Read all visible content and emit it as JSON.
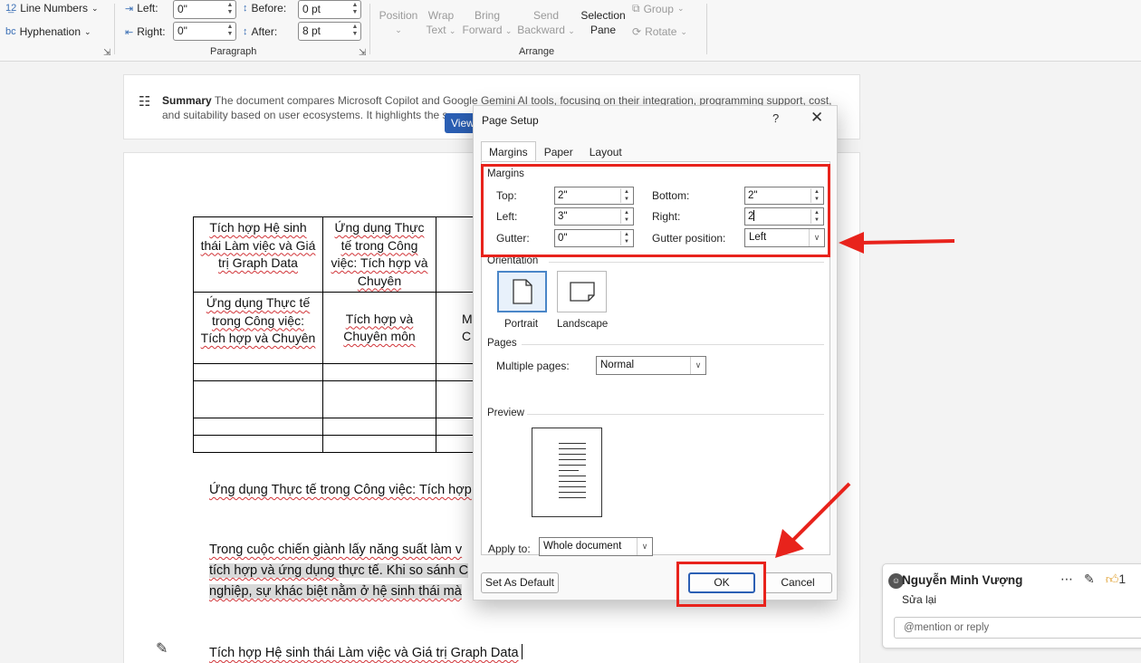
{
  "ribbon": {
    "line_numbers": "Line Numbers",
    "hyphenation": "Hyphenation",
    "indent_left_label": "Left:",
    "indent_left_value": "0\"",
    "indent_right_label": "Right:",
    "indent_right_value": "0\"",
    "spacing_before_label": "Before:",
    "spacing_before_value": "0 pt",
    "spacing_after_label": "After:",
    "spacing_after_value": "8 pt",
    "paragraph_group": "Paragraph",
    "position": "Position",
    "wrap_text": [
      "Wrap",
      "Text"
    ],
    "bring_forward": [
      "Bring",
      "Forward"
    ],
    "send_backward": [
      "Send",
      "Backward"
    ],
    "selection_pane": [
      "Selection",
      "Pane"
    ],
    "group": "Group",
    "rotate": "Rotate",
    "arrange_group": "Arrange"
  },
  "summary": {
    "label": "Summary",
    "text_line1": "The document compares Microsoft Copilot and Google Gemini AI tools, focusing on their integration, programming support, cost,",
    "text_line2": "and suitability based on user ecosystems. It highlights the s",
    "view_button": "View"
  },
  "document": {
    "table": {
      "r1c1": "Tích hợp Hệ sinh thái Làm việc và Giá trị Graph Data",
      "r1c2": "Ứng dụng Thực tế trong Công việc: Tích hợp và Chuyên",
      "r2c1": "Ứng dụng Thực tế trong Công việc: Tích hợp và Chuyên",
      "r2c2": "Tích hợp và Chuyên môn",
      "r2c3_partial": "M C"
    },
    "heading1": "Ứng dụng Thực tế trong Công việc: Tích hợp",
    "para_line1": "Trong cuộc chiến giành lấy năng suất làm v",
    "para_line2_a": "tích hợp và ứng dụng ",
    "para_line2_b": "thực tế. Khi so sánh C",
    "para_line3": "nghiệp, sự khác biệt nằm ở hệ sinh thái mà",
    "heading2": "Tích hợp Hệ sinh thái Làm việc và Giá trị Graph Data"
  },
  "dialog": {
    "title": "Page Setup",
    "help": "?",
    "close": "✕",
    "tabs": [
      "Margins",
      "Paper",
      "Layout"
    ],
    "margins_section": "Margins",
    "top_label": "Top:",
    "top_value": "2\"",
    "bottom_label": "Bottom:",
    "bottom_value": "2\"",
    "left_label": "Left:",
    "left_value": "3\"",
    "right_label": "Right:",
    "right_value": "2",
    "gutter_label": "Gutter:",
    "gutter_value": "0\"",
    "gutter_position_label": "Gutter position:",
    "gutter_position_value": "Left",
    "orientation_section": "Orientation",
    "portrait": "Portrait",
    "landscape": "Landscape",
    "pages_section": "Pages",
    "multiple_pages_label": "Multiple pages:",
    "multiple_pages_value": "Normal",
    "preview_section": "Preview",
    "apply_to_label": "Apply to:",
    "apply_to_value": "Whole document",
    "set_default_button": "Set As Default",
    "ok_button": "OK",
    "cancel_button": "Cancel"
  },
  "comment": {
    "author": "Nguyễn Minh Vượng",
    "text": "Sửa lại",
    "reply_placeholder": "@mention or reply",
    "like_count": "1"
  },
  "colors": {
    "annotation_red": "#e8231c",
    "accent_blue": "#2b5fb4",
    "spellcheck_red": "#d13438"
  }
}
